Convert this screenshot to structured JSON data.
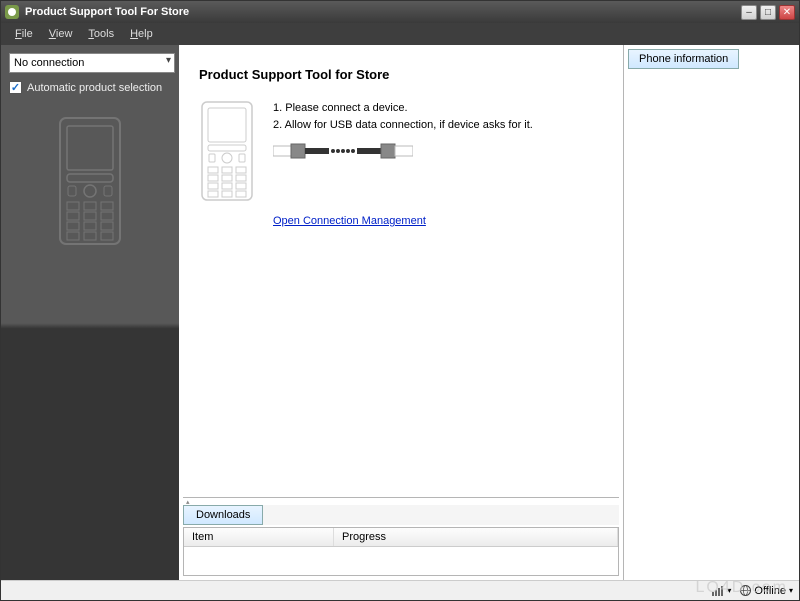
{
  "titlebar": {
    "title": "Product Support Tool For Store"
  },
  "menubar": {
    "items": [
      {
        "label": "File",
        "key": "F"
      },
      {
        "label": "View",
        "key": "V"
      },
      {
        "label": "Tools",
        "key": "T"
      },
      {
        "label": "Help",
        "key": "H"
      }
    ]
  },
  "sidebar": {
    "connection_selected": "No connection",
    "auto_select_label": "Automatic product selection",
    "auto_select_checked": true
  },
  "main": {
    "heading": "Product Support Tool for Store",
    "instructions": [
      "1. Please connect a device.",
      "2. Allow for USB data connection, if device asks for it."
    ],
    "link_label": "Open Connection Management"
  },
  "downloads": {
    "tab_label": "Downloads",
    "columns": {
      "item": "Item",
      "progress": "Progress"
    }
  },
  "right_panel": {
    "tab_label": "Phone information"
  },
  "statusbar": {
    "offline_label": "Offline"
  },
  "watermark": "LO4D.com"
}
